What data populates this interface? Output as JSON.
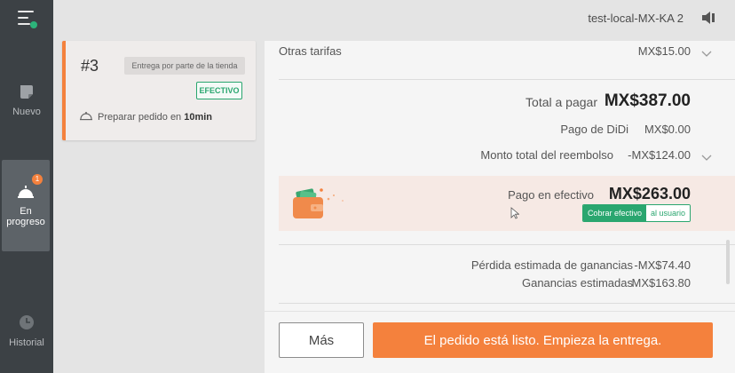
{
  "sidebar": {
    "items": [
      {
        "label": "Nuevo",
        "icon": "new-order-icon"
      },
      {
        "label": "En\nprogreso",
        "icon": "bell-icon",
        "badge": "1"
      },
      {
        "label": "Historial",
        "icon": "clock-icon"
      }
    ],
    "status_color": "#2cb37a"
  },
  "topbar": {
    "store_name": "test-local-MX-KA 2",
    "speaker_icon": "speaker-icon"
  },
  "order_card": {
    "number": "#3",
    "delivery_type": "Entrega por parte de la tienda",
    "payment_tag": "EFECTIVO",
    "prepare_text": "Preparar pedido en ",
    "prepare_time": "10min"
  },
  "summary": {
    "other_fees_label": "Otras tarifas",
    "other_fees_value": "MX$15.00",
    "total_label": "Total a pagar",
    "total_value": "MX$387.00",
    "didi_label": "Pago de DiDi",
    "didi_value": "MX$0.00",
    "refund_label": "Monto total del reembolso",
    "refund_value": "-MX$124.00",
    "cash_label": "Pago en efectivo",
    "cash_value": "MX$263.00",
    "cash_pill_a": "Cobrar efectivo",
    "cash_pill_b": "al usuario",
    "loss_label": "Pérdida estimada de ganancias",
    "loss_value": "-MX$74.40",
    "earnings_label": "Ganancias estimadas",
    "earnings_value": "MX$163.80"
  },
  "footer": {
    "more_label": "Más",
    "ready_label": "El pedido está listo. Empieza la entrega."
  },
  "colors": {
    "accent": "#f4813d",
    "green": "#2aa66f",
    "sidebar": "#3c4145"
  }
}
